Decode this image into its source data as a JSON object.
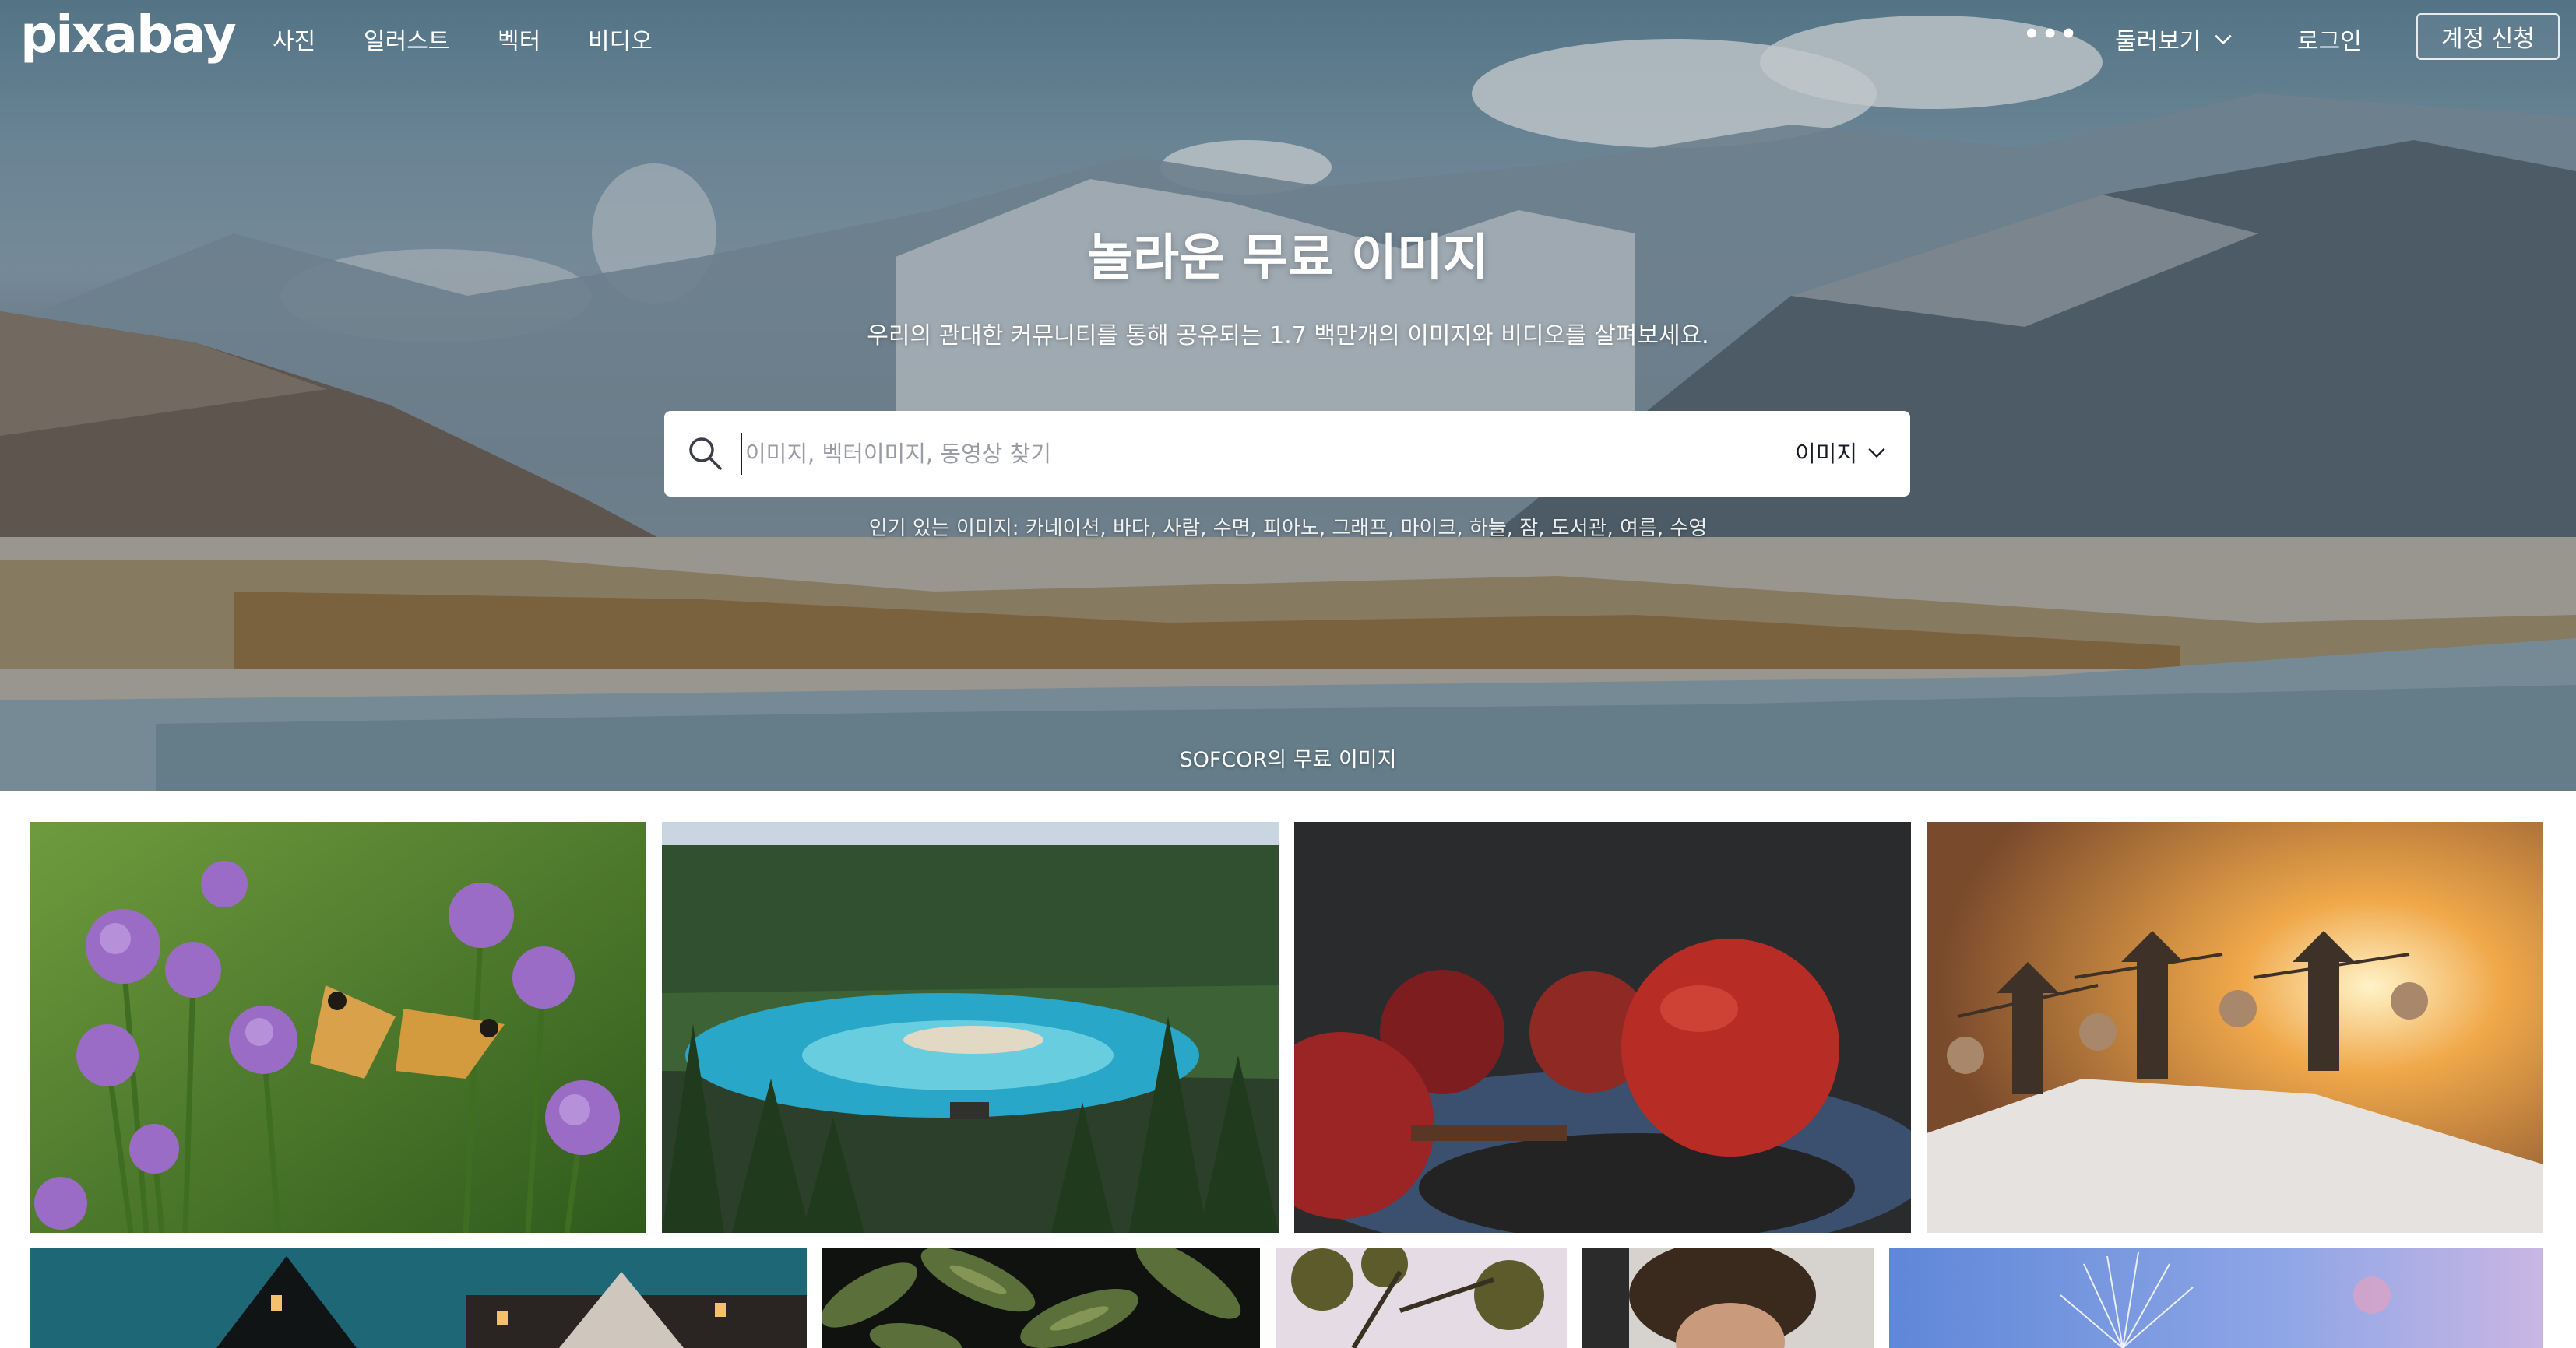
{
  "nav": {
    "logo": "pixabay",
    "links": [
      "사진",
      "일러스트",
      "벡터",
      "비디오"
    ],
    "more_icon": "more-dots-icon",
    "explore_label": "둘러보기",
    "login_label": "로그인",
    "signup_label": "계정 신청"
  },
  "hero": {
    "title": "놀라운 무료 이미지",
    "subtitle": "우리의 관대한 커뮤니티를 통해 공유되는 1.7 백만개의 이미지와 비디오를 살펴보세요.",
    "search_placeholder": "이미지, 벡터이미지, 동영상 찾기",
    "search_type": "이미지",
    "popular_text": "인기 있는 이미지: 카네이션, 바다, 사람, 수면, 피아노, 그래프, 마이크, 하늘, 잠, 도서관, 여름, 수영",
    "credit": "SOFCOR의 무료 이미지"
  },
  "colors": {
    "accent": "#191b26",
    "white": "#ffffff"
  },
  "gallery": {
    "row1": [
      "chives-butterfly-photo",
      "mountain-lake-photo",
      "red-apples-photo",
      "salt-harvest-photo"
    ],
    "row2": [
      "building-night-photo",
      "leaf-pattern-photo",
      "tree-branches-photo",
      "curly-hair-portrait-photo",
      "dandelion-sky-photo"
    ]
  }
}
